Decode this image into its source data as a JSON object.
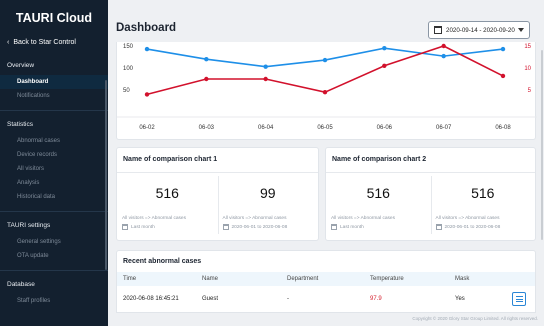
{
  "sidebar": {
    "brand": "TAURI Cloud",
    "back_label": "Back to Star Control",
    "sections": [
      {
        "title": "Overview",
        "items": [
          "Dashboard",
          "Notifications"
        ]
      },
      {
        "title": "Statistics",
        "items": [
          "Abnormal cases",
          "Device records",
          "All visitors",
          "Analysis",
          "Historical data"
        ]
      },
      {
        "title": "TAURI settings",
        "items": [
          "General settings",
          "OTA update"
        ]
      },
      {
        "title": "Database",
        "items": [
          "Staff profiles"
        ]
      }
    ],
    "active_item": "Dashboard"
  },
  "header": {
    "title": "Dashboard",
    "date_range": "2020-09-14 - 2020-09-20"
  },
  "chart_data": {
    "type": "line",
    "x": [
      "06-02",
      "06-03",
      "06-04",
      "06-05",
      "06-06",
      "06-07",
      "06-08"
    ],
    "series": [
      {
        "values": [
          143,
          120,
          103,
          118,
          145,
          127,
          143
        ],
        "axis": "left",
        "color": "#1e8fe8"
      },
      {
        "values": [
          4,
          7.5,
          7.5,
          4.5,
          10.5,
          15,
          8.2
        ],
        "axis": "right",
        "color": "#d2112c"
      }
    ],
    "left_ticks": [
      "150",
      "100",
      "50"
    ],
    "right_ticks": [
      "15",
      "10",
      "5"
    ],
    "left_ylim": [
      0,
      150
    ],
    "right_ylim": [
      0,
      15
    ]
  },
  "comparison_cards": [
    {
      "title": "Name of comparison chart 1",
      "stats": [
        {
          "value": "516",
          "sub": "All visitors => Abnormal cases",
          "date": "Last month"
        },
        {
          "value": "99",
          "sub": "All visitors => Abnormal cases",
          "date": "2020-06-01 to 2020-06-08"
        }
      ]
    },
    {
      "title": "Name of comparison chart 2",
      "stats": [
        {
          "value": "516",
          "sub": "All visitors => Abnormal cases",
          "date": "Last month"
        },
        {
          "value": "516",
          "sub": "All visitors => Abnormal cases",
          "date": "2020-06-01 to 2020-06-08"
        }
      ]
    }
  ],
  "recent": {
    "title": "Recent abnormal cases",
    "columns": [
      "Time",
      "Name",
      "Department",
      "Temperature",
      "Mask"
    ],
    "rows": [
      [
        "2020-06-08 16:45:21",
        "Guest",
        "-",
        "97.9",
        "Yes"
      ]
    ]
  },
  "footer": "Copyright © 2020 Glory Star Group Limited. All rights reserved.",
  "colors": {
    "sidebar_bg": "#13202f",
    "blue_series": "#1e8fe8",
    "red_series": "#d2112c",
    "accent": "#2a86d6"
  }
}
